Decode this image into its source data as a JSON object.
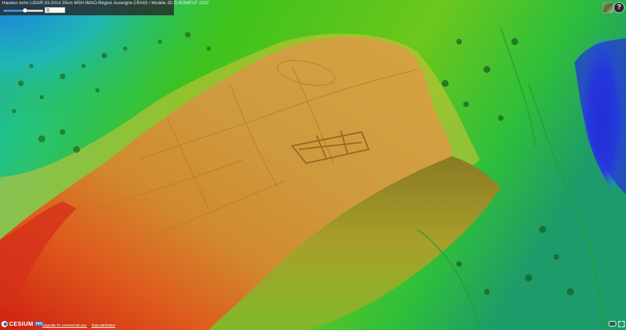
{
  "panel": {
    "title": "Hauteur écho LIDAR 03-2014 25cm MSH-IMAO-Région Auvergne CRAIG / Modèle 3D D.ROMEUF 2022",
    "slider_fraction": 0.55,
    "value": "0"
  },
  "toolbar": {
    "imagery_icon": "layers-thumbnail-icon",
    "help_label": "?"
  },
  "credits": {
    "logo_text": "CESIUM",
    "ion_label": "ion",
    "upgrade_text": "Upgrade for commercial use.",
    "attribution_text": "Data attribution"
  },
  "colors": {
    "panel_bg": "#282828",
    "slider_fill": "#3f8fe0",
    "low_elevation": "#1a3fd6",
    "mid_elevation": "#2ec41f",
    "high_elevation": "#e8a22a",
    "peak_elevation": "#d61f12"
  },
  "icons": [
    "layers-thumbnail-icon",
    "help-icon",
    "vr-icon",
    "fullscreen-icon",
    "cesium-logo-icon"
  ]
}
